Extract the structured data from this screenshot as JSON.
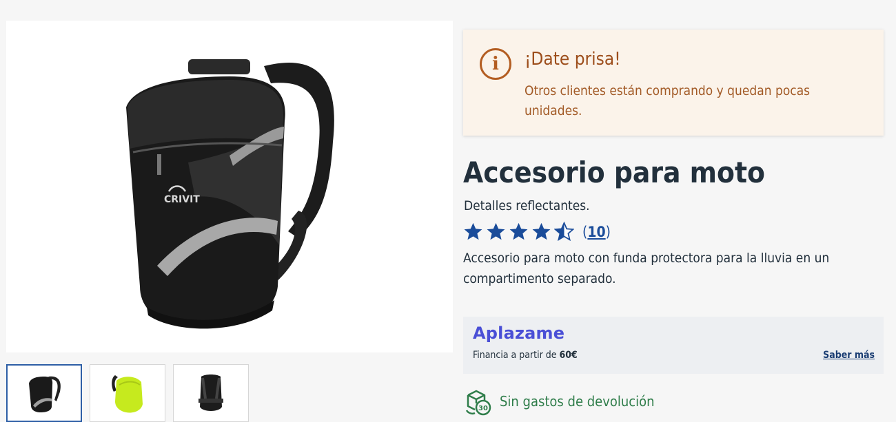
{
  "product": {
    "brand_print": "CRIVIT",
    "title": "Accesorio para moto",
    "subtitle": "Detalles reflectantes.",
    "description": "Accesorio para moto con funda protectora para la lluvia en un compartimento separado.",
    "rating": 4.5,
    "review_open": "(",
    "review_count": "10",
    "review_close": ")"
  },
  "alert": {
    "icon": "info-icon",
    "icon_glyph": "i",
    "title": "¡Date prisa!",
    "text": "Otros clientes están comprando y quedan pocas unidades."
  },
  "financing": {
    "logo": "Aplazame",
    "text_prefix": "Financia a partir de ",
    "amount": "60€",
    "link": "Saber más"
  },
  "returns": {
    "icon": "return-box-icon",
    "icon_label": "30",
    "text": "Sin gastos de devolución"
  },
  "gallery": {
    "thumbnails": [
      {
        "name": "backpack-front",
        "selected": true
      },
      {
        "name": "backpack-rain-cover",
        "selected": false
      },
      {
        "name": "backpack-back",
        "selected": false
      }
    ]
  },
  "colors": {
    "alert_bg": "#fbf3ea",
    "alert_accent": "#b35d22",
    "star": "#1a4c9a",
    "aplazame": "#4a4fd6",
    "returns": "#2f7d4a"
  }
}
